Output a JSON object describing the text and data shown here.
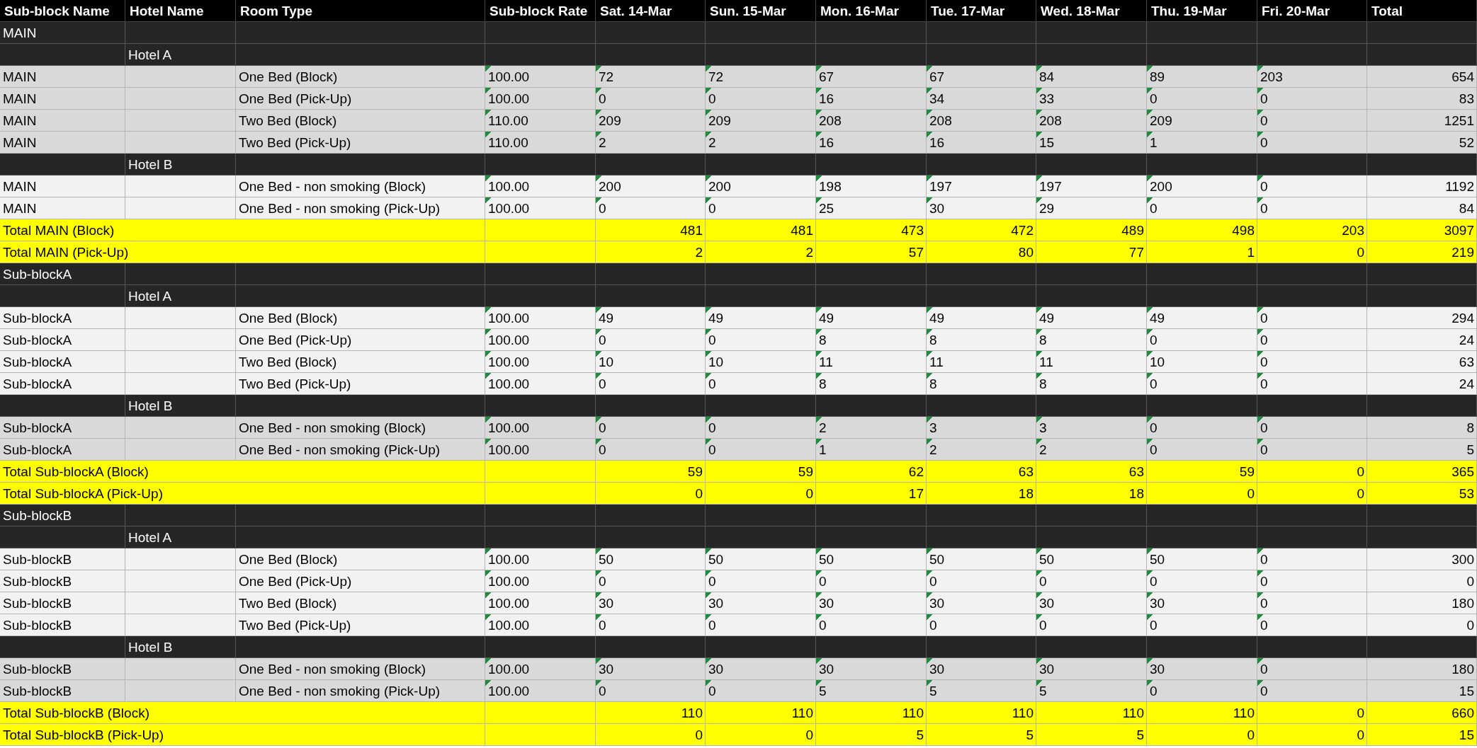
{
  "columns": [
    "Sub-block Name",
    "Hotel Name",
    "Room Type",
    "Sub-block Rate",
    "Sat. 14-Mar",
    "Sun. 15-Mar",
    "Mon. 16-Mar",
    "Tue. 17-Mar",
    "Wed. 18-Mar",
    "Thu. 19-Mar",
    "Fri. 20-Mar",
    "Total"
  ],
  "rows": [
    {
      "kind": "section",
      "label": "MAIN"
    },
    {
      "kind": "hotel",
      "label": "Hotel A"
    },
    {
      "kind": "data",
      "shaded": true,
      "flagged": true,
      "block": "MAIN",
      "room": "One Bed (Block)",
      "rate": "100.00",
      "days": [
        "72",
        "72",
        "67",
        "67",
        "84",
        "89",
        "203"
      ],
      "total": "654"
    },
    {
      "kind": "data",
      "shaded": true,
      "flagged": true,
      "block": "MAIN",
      "room": "One Bed (Pick-Up)",
      "rate": "100.00",
      "days": [
        "0",
        "0",
        "16",
        "34",
        "33",
        "0",
        "0"
      ],
      "total": "83"
    },
    {
      "kind": "data",
      "shaded": true,
      "flagged": true,
      "block": "MAIN",
      "room": "Two Bed (Block)",
      "rate": "110.00",
      "days": [
        "209",
        "209",
        "208",
        "208",
        "208",
        "209",
        "0"
      ],
      "total": "1251"
    },
    {
      "kind": "data",
      "shaded": true,
      "flagged": true,
      "block": "MAIN",
      "room": "Two Bed (Pick-Up)",
      "rate": "110.00",
      "days": [
        "2",
        "2",
        "16",
        "16",
        "15",
        "1",
        "0"
      ],
      "total": "52"
    },
    {
      "kind": "hotel",
      "label": "Hotel B"
    },
    {
      "kind": "data",
      "shaded": false,
      "flagged": true,
      "block": "MAIN",
      "room": "One Bed - non smoking (Block)",
      "rate": "100.00",
      "days": [
        "200",
        "200",
        "198",
        "197",
        "197",
        "200",
        "0"
      ],
      "total": "1192"
    },
    {
      "kind": "data",
      "shaded": false,
      "flagged": true,
      "block": "MAIN",
      "room": "One Bed - non smoking (Pick-Up)",
      "rate": "100.00",
      "days": [
        "0",
        "0",
        "25",
        "30",
        "29",
        "0",
        "0"
      ],
      "total": "84"
    },
    {
      "kind": "total",
      "label": "Total MAIN (Block)",
      "days": [
        "481",
        "481",
        "473",
        "472",
        "489",
        "498",
        "203"
      ],
      "total": "3097"
    },
    {
      "kind": "total",
      "label": "Total MAIN (Pick-Up)",
      "days": [
        "2",
        "2",
        "57",
        "80",
        "77",
        "1",
        "0"
      ],
      "total": "219"
    },
    {
      "kind": "section",
      "label": "Sub-blockA"
    },
    {
      "kind": "hotel",
      "label": "Hotel A"
    },
    {
      "kind": "data",
      "shaded": false,
      "flagged": true,
      "block": "Sub-blockA",
      "room": "One Bed (Block)",
      "rate": "100.00",
      "days": [
        "49",
        "49",
        "49",
        "49",
        "49",
        "49",
        "0"
      ],
      "total": "294"
    },
    {
      "kind": "data",
      "shaded": false,
      "flagged": true,
      "block": "Sub-blockA",
      "room": "One Bed (Pick-Up)",
      "rate": "100.00",
      "days": [
        "0",
        "0",
        "8",
        "8",
        "8",
        "0",
        "0"
      ],
      "total": "24"
    },
    {
      "kind": "data",
      "shaded": false,
      "flagged": true,
      "block": "Sub-blockA",
      "room": "Two Bed (Block)",
      "rate": "100.00",
      "days": [
        "10",
        "10",
        "11",
        "11",
        "11",
        "10",
        "0"
      ],
      "total": "63"
    },
    {
      "kind": "data",
      "shaded": false,
      "flagged": true,
      "block": "Sub-blockA",
      "room": "Two Bed (Pick-Up)",
      "rate": "100.00",
      "days": [
        "0",
        "0",
        "8",
        "8",
        "8",
        "0",
        "0"
      ],
      "total": "24"
    },
    {
      "kind": "hotel",
      "label": "Hotel B"
    },
    {
      "kind": "data",
      "shaded": true,
      "flagged": true,
      "block": "Sub-blockA",
      "room": "One Bed - non smoking (Block)",
      "rate": "100.00",
      "days": [
        "0",
        "0",
        "2",
        "3",
        "3",
        "0",
        "0"
      ],
      "total": "8"
    },
    {
      "kind": "data",
      "shaded": true,
      "flagged": true,
      "block": "Sub-blockA",
      "room": "One Bed - non smoking (Pick-Up)",
      "rate": "100.00",
      "days": [
        "0",
        "0",
        "1",
        "2",
        "2",
        "0",
        "0"
      ],
      "total": "5"
    },
    {
      "kind": "total",
      "label": "Total Sub-blockA (Block)",
      "days": [
        "59",
        "59",
        "62",
        "63",
        "63",
        "59",
        "0"
      ],
      "total": "365"
    },
    {
      "kind": "total",
      "label": "Total Sub-blockA (Pick-Up)",
      "days": [
        "0",
        "0",
        "17",
        "18",
        "18",
        "0",
        "0"
      ],
      "total": "53"
    },
    {
      "kind": "section",
      "label": "Sub-blockB"
    },
    {
      "kind": "hotel",
      "label": "Hotel A"
    },
    {
      "kind": "data",
      "shaded": false,
      "flagged": true,
      "block": "Sub-blockB",
      "room": "One Bed (Block)",
      "rate": "100.00",
      "days": [
        "50",
        "50",
        "50",
        "50",
        "50",
        "50",
        "0"
      ],
      "total": "300"
    },
    {
      "kind": "data",
      "shaded": false,
      "flagged": true,
      "block": "Sub-blockB",
      "room": "One Bed (Pick-Up)",
      "rate": "100.00",
      "days": [
        "0",
        "0",
        "0",
        "0",
        "0",
        "0",
        "0"
      ],
      "total": "0"
    },
    {
      "kind": "data",
      "shaded": false,
      "flagged": true,
      "block": "Sub-blockB",
      "room": "Two Bed (Block)",
      "rate": "100.00",
      "days": [
        "30",
        "30",
        "30",
        "30",
        "30",
        "30",
        "0"
      ],
      "total": "180"
    },
    {
      "kind": "data",
      "shaded": false,
      "flagged": true,
      "block": "Sub-blockB",
      "room": "Two Bed (Pick-Up)",
      "rate": "100.00",
      "days": [
        "0",
        "0",
        "0",
        "0",
        "0",
        "0",
        "0"
      ],
      "total": "0"
    },
    {
      "kind": "hotel",
      "label": "Hotel B"
    },
    {
      "kind": "data",
      "shaded": true,
      "flagged": true,
      "block": "Sub-blockB",
      "room": "One Bed - non smoking (Block)",
      "rate": "100.00",
      "days": [
        "30",
        "30",
        "30",
        "30",
        "30",
        "30",
        "0"
      ],
      "total": "180"
    },
    {
      "kind": "data",
      "shaded": true,
      "flagged": true,
      "block": "Sub-blockB",
      "room": "One Bed - non smoking (Pick-Up)",
      "rate": "100.00",
      "days": [
        "0",
        "0",
        "5",
        "5",
        "5",
        "0",
        "0"
      ],
      "total": "15"
    },
    {
      "kind": "total",
      "label": "Total Sub-blockB (Block)",
      "days": [
        "110",
        "110",
        "110",
        "110",
        "110",
        "110",
        "0"
      ],
      "total": "660"
    },
    {
      "kind": "total",
      "label": "Total Sub-blockB (Pick-Up)",
      "days": [
        "0",
        "0",
        "5",
        "5",
        "5",
        "0",
        "0"
      ],
      "total": "15"
    }
  ]
}
